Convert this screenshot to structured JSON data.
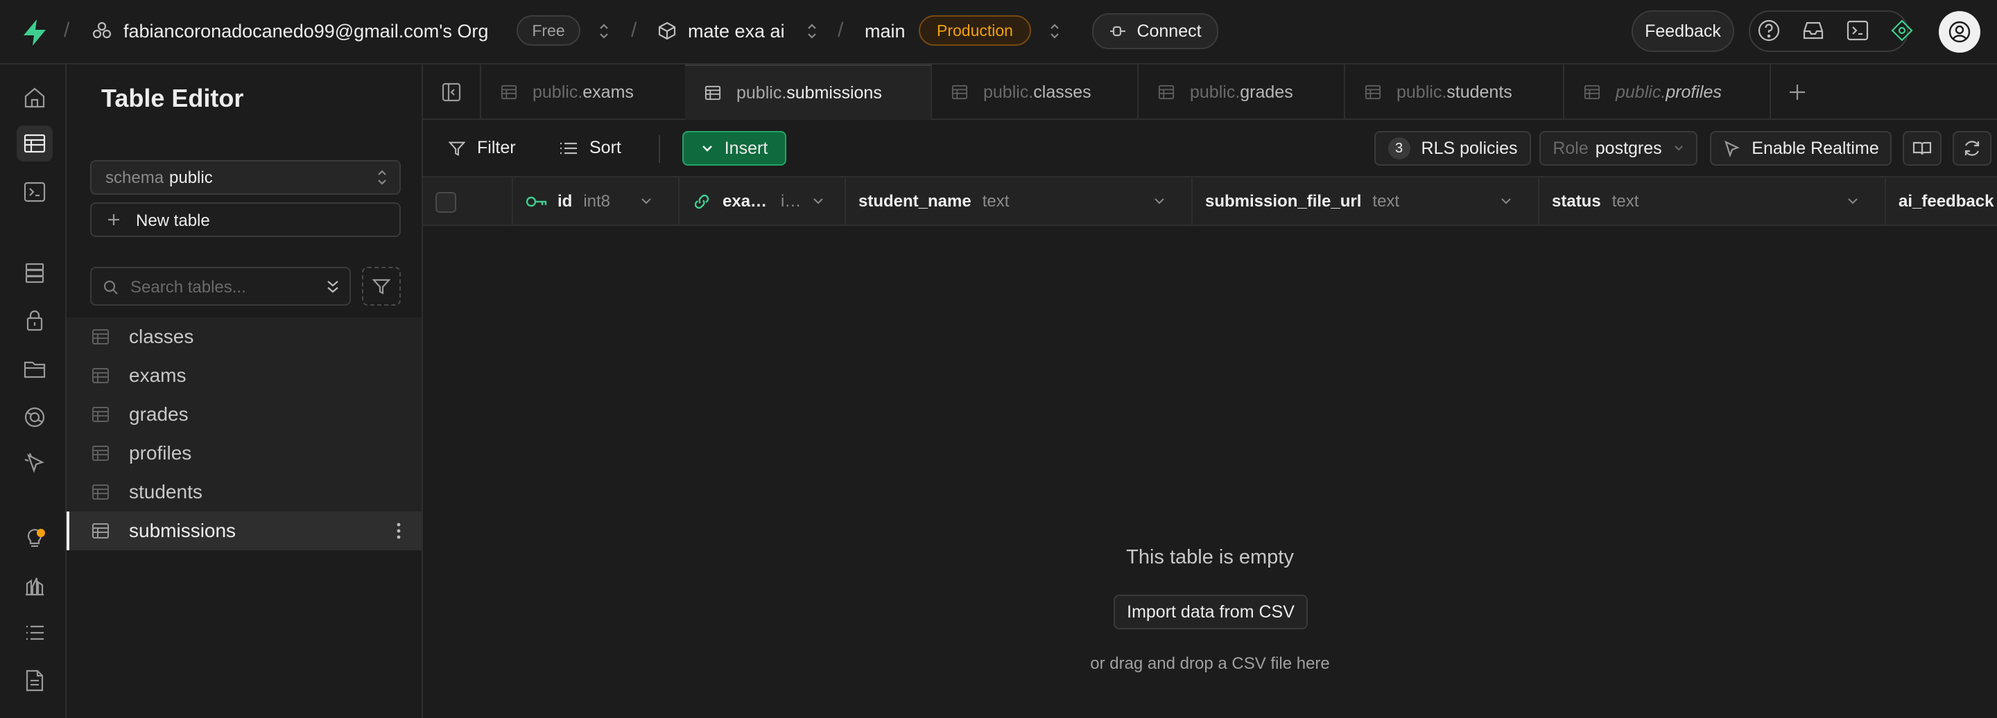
{
  "topbar": {
    "org": "fabiancoronadocanedo99@gmail.com's Org",
    "plan": "Free",
    "project": "mate exa ai",
    "branch": "main",
    "environment": "Production",
    "connect_label": "Connect",
    "feedback_label": "Feedback"
  },
  "side": {
    "title": "Table Editor",
    "schema_label": "schema",
    "schema_value": "public",
    "new_table_label": "New table",
    "search_placeholder": "Search tables...",
    "tables": [
      "classes",
      "exams",
      "grades",
      "profiles",
      "students",
      "submissions"
    ],
    "active_table": "submissions"
  },
  "tabs": [
    {
      "prefix": "public.",
      "name": "exams"
    },
    {
      "prefix": "public.",
      "name": "submissions"
    },
    {
      "prefix": "public.",
      "name": "classes"
    },
    {
      "prefix": "public.",
      "name": "grades"
    },
    {
      "prefix": "public.",
      "name": "students"
    },
    {
      "prefix": "public.",
      "name": "profiles"
    }
  ],
  "toolbar": {
    "filter_label": "Filter",
    "sort_label": "Sort",
    "insert_label": "Insert",
    "rls_count": "3",
    "rls_label": "RLS policies",
    "role_label": "Role",
    "role_value": "postgres",
    "realtime_label": "Enable Realtime"
  },
  "columns": [
    {
      "name": "id",
      "type": "int8"
    },
    {
      "name": "exa…",
      "type": "i…"
    },
    {
      "name": "student_name",
      "type": "text"
    },
    {
      "name": "submission_file_url",
      "type": "text"
    },
    {
      "name": "status",
      "type": "text"
    },
    {
      "name": "ai_feedback",
      "type": ""
    }
  ],
  "empty": {
    "title": "This table is empty",
    "import_label": "Import data from CSV",
    "drag_hint": "or drag and drop a CSV file here"
  },
  "colors": {
    "accent": "#3ecf8e",
    "production": "#f1a10d",
    "background": "#1c1c1c"
  }
}
